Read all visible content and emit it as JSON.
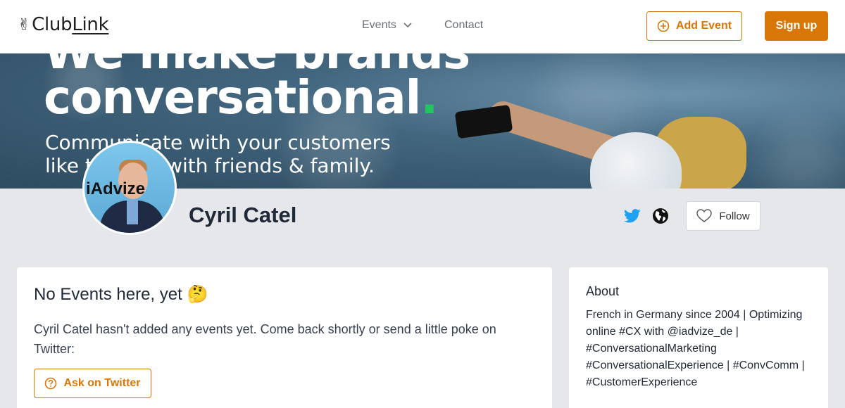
{
  "nav": {
    "logo_prefix": "Club",
    "logo_link": "Link",
    "logo_icon": "victory-hand-icon",
    "events_label": "Events",
    "contact_label": "Contact",
    "add_event_label": "Add Event",
    "signup_label": "Sign up"
  },
  "banner": {
    "line1": "We make brands",
    "line2": "conversational",
    "line2_dot": ".",
    "line3a": "Communicate with your customers",
    "line3b": "like they do with friends & family."
  },
  "profile": {
    "avatar_text": "iAdvize",
    "name": "Cyril Catel",
    "follow_label": "Follow",
    "icons": [
      "twitter-icon",
      "globe-icon",
      "heart-icon"
    ]
  },
  "events": {
    "title": "No Events here, yet 🤔",
    "text": "Cyril Catel hasn't added any events yet. Come back shortly or send a little poke on Twitter:",
    "ask_label": "Ask on Twitter"
  },
  "about": {
    "title": "About",
    "text": "French in Germany since 2004 | Optimizing online #CX with @iadvize_de | #ConversationalMarketing #ConversationalExperience | #ConvComm | #CustomerExperience"
  },
  "colors": {
    "accent": "#d97706",
    "twitter": "#1da1f2",
    "banner_dot": "#22c55e"
  }
}
